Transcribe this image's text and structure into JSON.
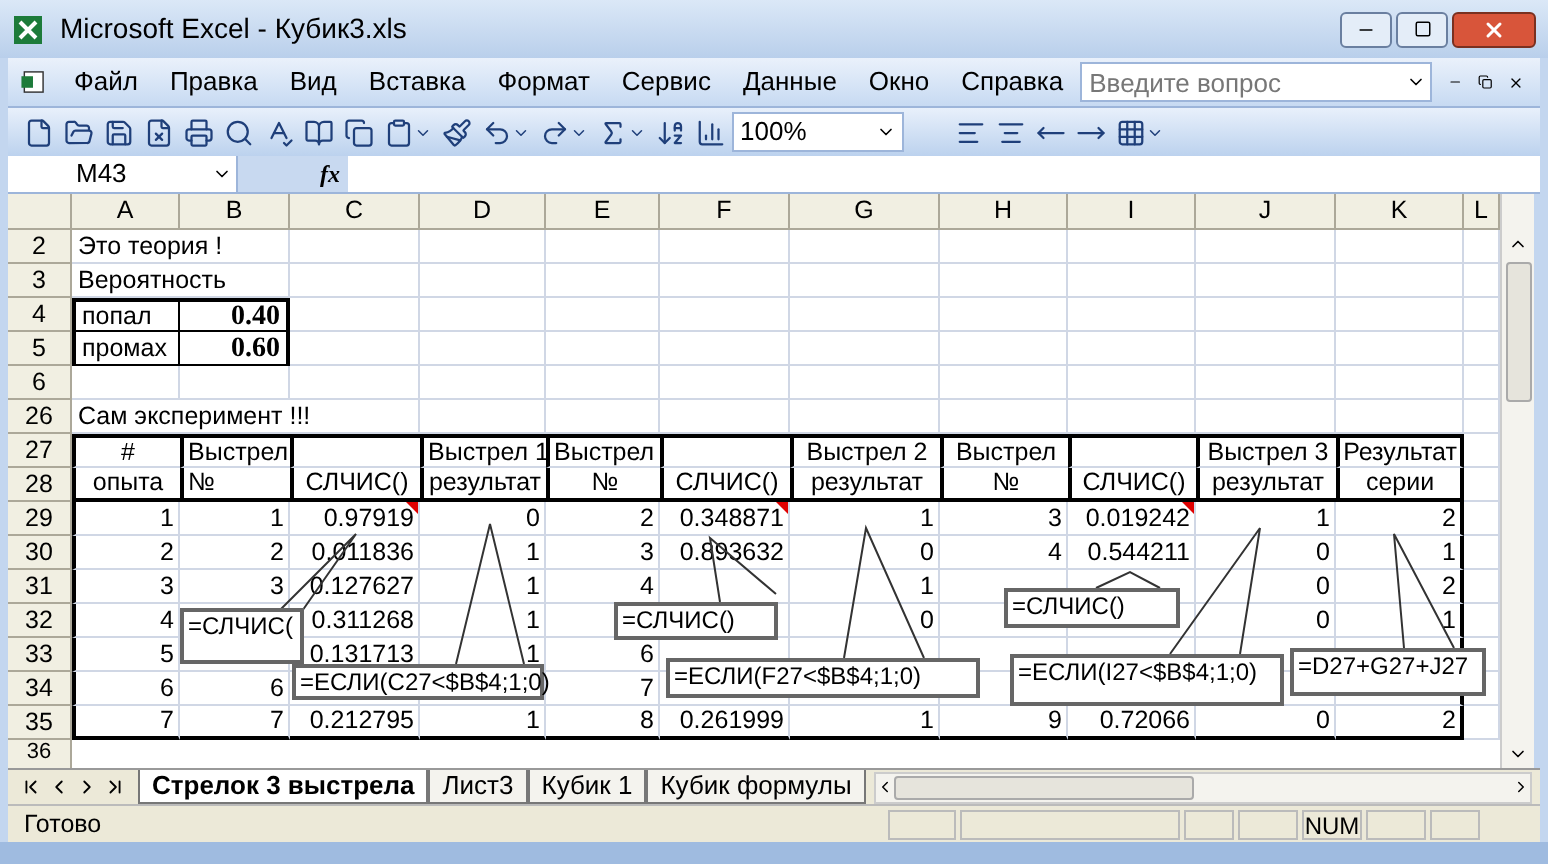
{
  "window": {
    "title": "Microsoft Excel - Кубик3.xls"
  },
  "menu": [
    "Файл",
    "Правка",
    "Вид",
    "Вставка",
    "Формат",
    "Сервис",
    "Данные",
    "Окно",
    "Справка"
  ],
  "help_field": {
    "placeholder": "Введите вопрос"
  },
  "toolbar": {
    "zoom": "100%"
  },
  "formula_bar": {
    "name_box": "M43",
    "fx_label": "fx"
  },
  "columns": [
    "A",
    "B",
    "C",
    "D",
    "E",
    "F",
    "G",
    "H",
    "I",
    "J",
    "K",
    "L"
  ],
  "rows": [
    {
      "kind": "text",
      "number": "2",
      "text": "Это теория !"
    },
    {
      "kind": "text",
      "number": "3",
      "text": "Вероятность"
    },
    {
      "kind": "param",
      "number": "4",
      "label": "попал",
      "value": "0.40"
    },
    {
      "kind": "param",
      "number": "5",
      "label": "промах",
      "value": "0.60"
    },
    {
      "kind": "blank",
      "number": "6"
    },
    {
      "kind": "text",
      "number": "26",
      "text": "Сам эксперимент !!!"
    }
  ],
  "table": {
    "header_rows": [
      {
        "number": "27",
        "cells": [
          "#",
          "Выстрел",
          null,
          "Выстрел 1",
          "Выстрел",
          null,
          "Выстрел 2",
          "Выстрел",
          null,
          "Выстрел 3",
          "Результат"
        ]
      },
      {
        "number": "28",
        "cells": [
          "опыта",
          "№",
          "СЛЧИС()",
          "результат",
          "№",
          "СЛЧИС()",
          "результат",
          "№",
          "СЛЧИС()",
          "результат",
          "серии"
        ]
      }
    ],
    "rows": [
      {
        "number": "29",
        "cells": [
          "1",
          "1",
          {
            "text": "0.97919",
            "comment": true
          },
          "0",
          "2",
          {
            "text": "0.348871",
            "comment": true
          },
          "1",
          "3",
          {
            "text": "0.019242",
            "comment": true
          },
          "1",
          "2"
        ]
      },
      {
        "number": "30",
        "cells": [
          "2",
          "2",
          "0.011836",
          "1",
          "3",
          "0.893632",
          "0",
          "4",
          "0.544211",
          "0",
          "1"
        ]
      },
      {
        "number": "31",
        "cells": [
          "3",
          "3",
          "0.127627",
          "1",
          "4",
          null,
          "1",
          null,
          null,
          "0",
          "2"
        ]
      },
      {
        "number": "32",
        "cells": [
          "4",
          null,
          "0.311268",
          "1",
          null,
          null,
          "0",
          null,
          null,
          "0",
          "1"
        ]
      },
      {
        "number": "33",
        "cells": [
          "5",
          null,
          "0.131713",
          "1",
          "6",
          null,
          null,
          null,
          null,
          null,
          null
        ]
      },
      {
        "number": "34",
        "cells": [
          "6",
          "6",
          null,
          null,
          "7",
          null,
          null,
          null,
          null,
          null,
          null
        ]
      },
      {
        "number": "35",
        "cells": [
          "7",
          "7",
          "0.212795",
          "1",
          "8",
          "0.261999",
          "1",
          "9",
          "0.72066",
          "0",
          "2"
        ]
      }
    ]
  },
  "last_row": "36",
  "callouts": [
    {
      "text": "=СЛЧИС("
    },
    {
      "text": "=ЕСЛИ(C27<$B$4;1;0)"
    },
    {
      "text": "=СЛЧИС()"
    },
    {
      "text": "=ЕСЛИ(F27<$B$4;1;0)"
    },
    {
      "text": "=СЛЧИС()"
    },
    {
      "text": "=ЕСЛИ(I27<$B$4;1;0)"
    },
    {
      "text": "=D27+G27+J27"
    }
  ],
  "sheet_tabs": [
    {
      "label": "Стрелок 3 выстрела",
      "selected": true
    },
    {
      "label": "Лист3",
      "selected": false
    },
    {
      "label": "Кубик 1",
      "selected": false
    },
    {
      "label": "Кубик формулы",
      "selected": false
    }
  ],
  "status_bar": {
    "text": "Готово",
    "indicator": "NUM"
  }
}
